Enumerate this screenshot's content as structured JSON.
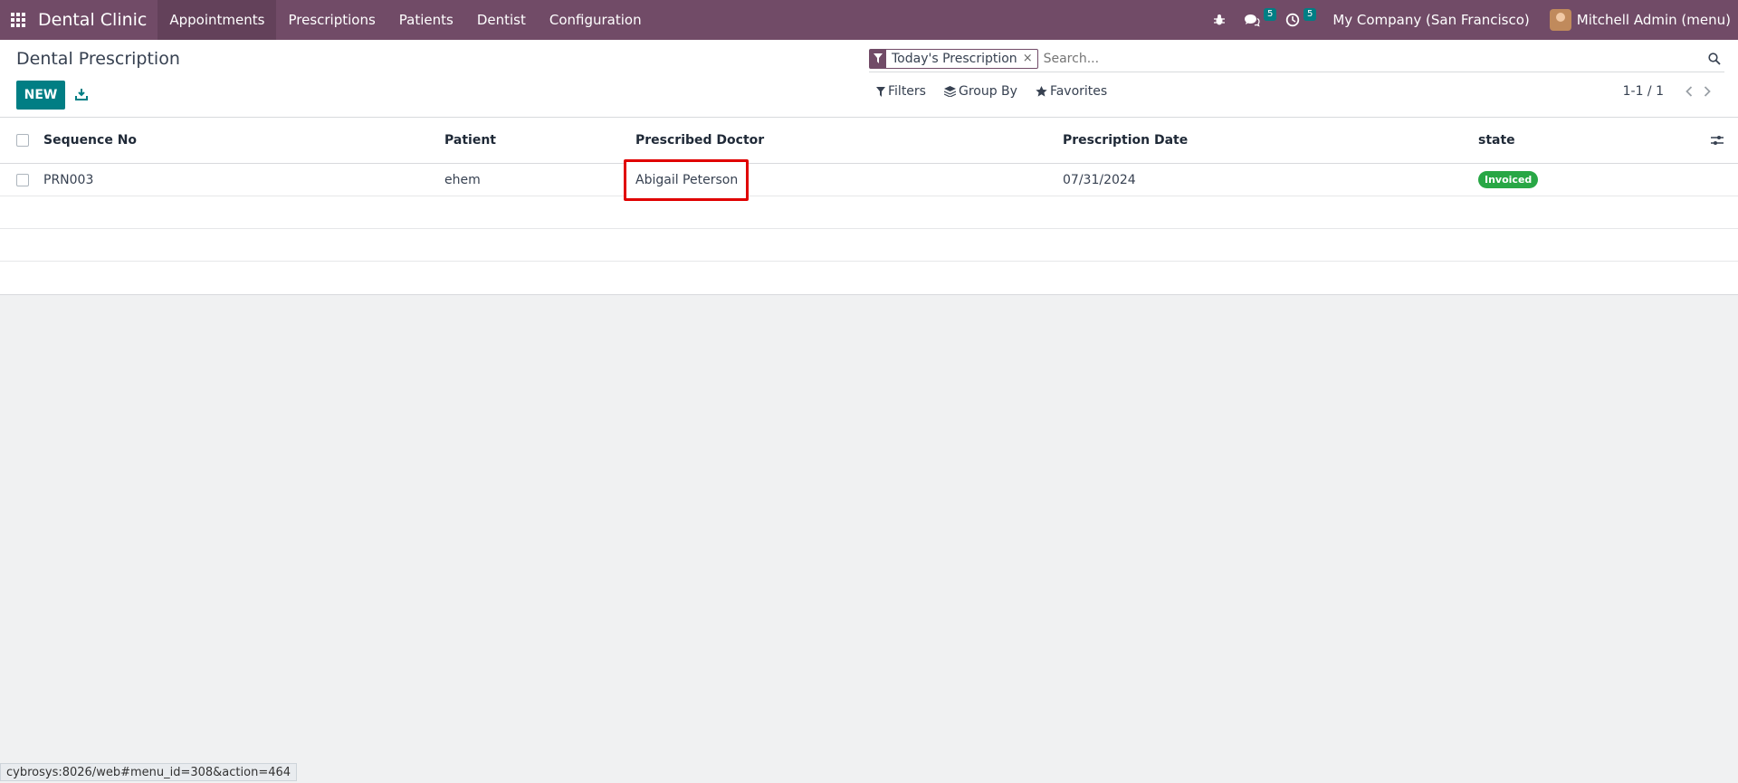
{
  "navbar": {
    "brand": "Dental Clinic",
    "menu": [
      "Appointments",
      "Prescriptions",
      "Patients",
      "Dentist",
      "Configuration"
    ],
    "messages_badge": "5",
    "activities_badge": "5",
    "company": "My Company (San Francisco)",
    "user": "Mitchell Admin (menu)"
  },
  "control": {
    "title": "Dental Prescription",
    "new_label": "NEW",
    "facet_label": "Today's Prescription",
    "facet_close": "×",
    "search_placeholder": "Search...",
    "filters_label": "Filters",
    "groupby_label": "Group By",
    "favorites_label": "Favorites",
    "pager": "1-1 / 1"
  },
  "table": {
    "columns": [
      "Sequence No",
      "Patient",
      "Prescribed Doctor",
      "Prescription Date",
      "state"
    ],
    "rows": [
      {
        "sequence": "PRN003",
        "patient": "ehem",
        "doctor": "Abigail Peterson",
        "date": "07/31/2024",
        "state": "Invoiced"
      }
    ]
  },
  "status_url": "cybrosys:8026/web#menu_id=308&action=464",
  "colors": {
    "brand": "#714b67",
    "primary": "#017e84",
    "success": "#28a745",
    "highlight": "#e00000"
  }
}
